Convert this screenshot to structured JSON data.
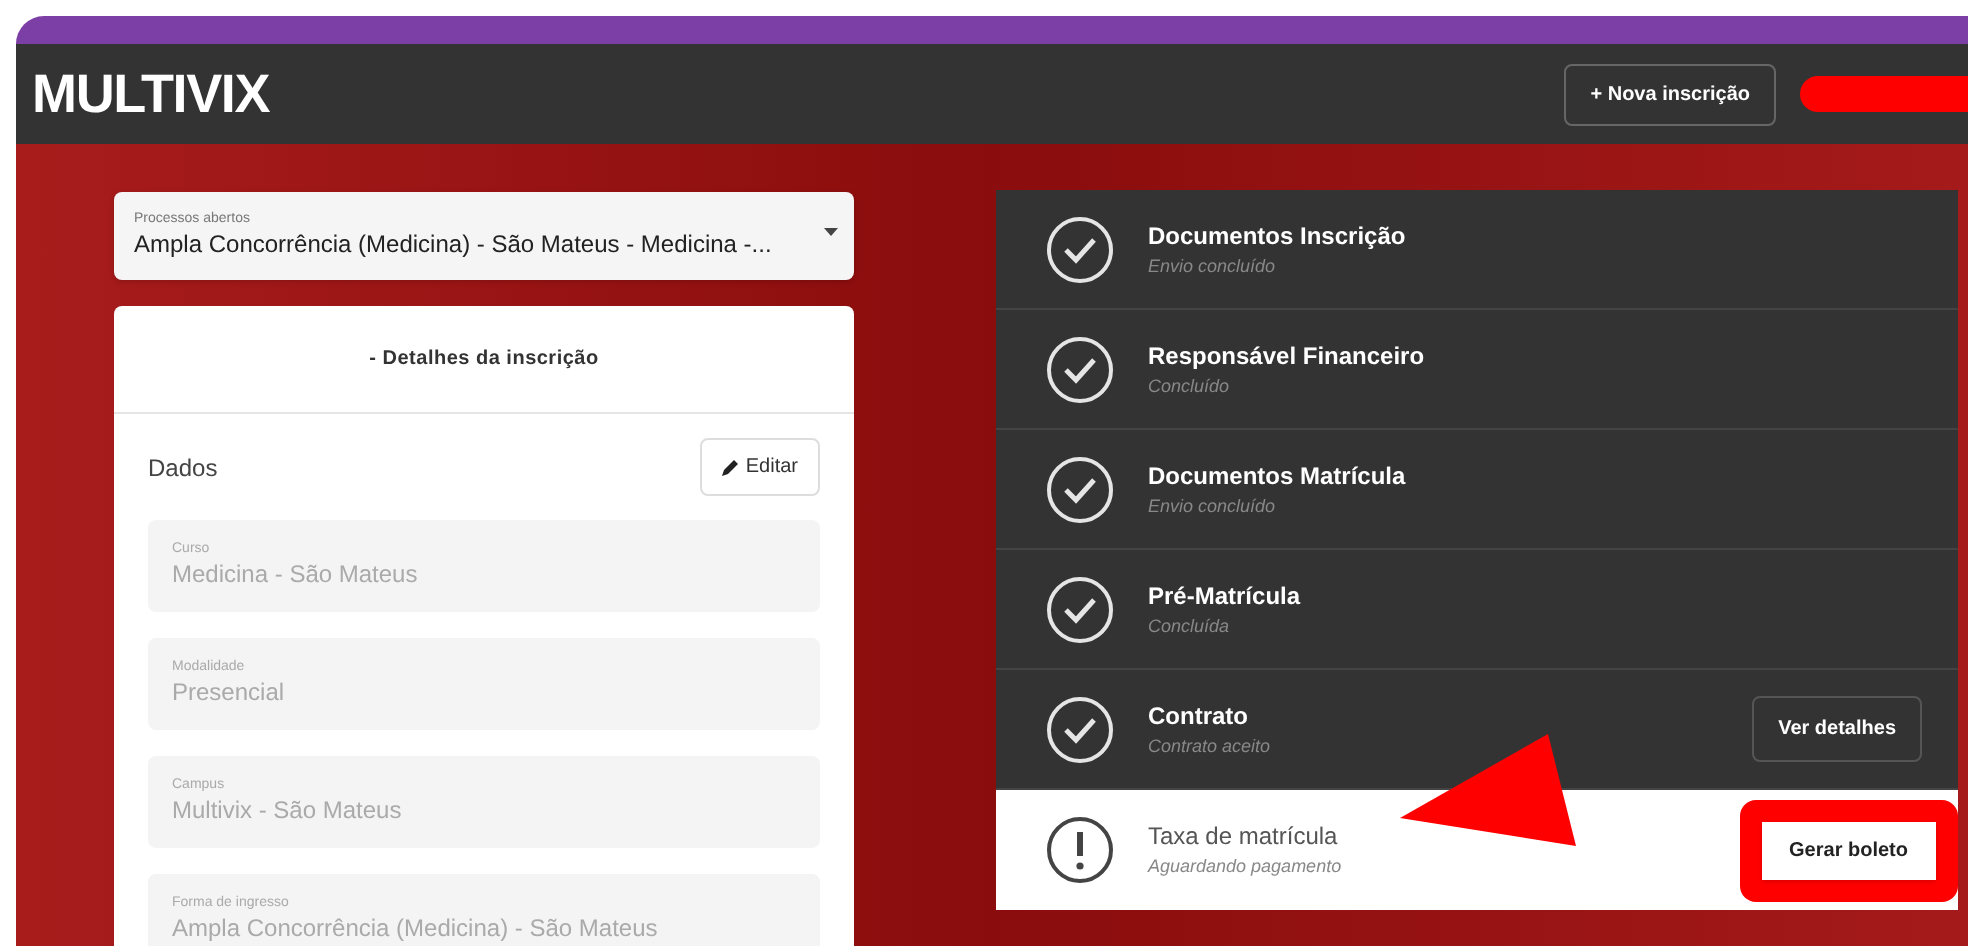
{
  "header": {
    "logo": "MULTIVIX",
    "new_button": "+ Nova inscrição"
  },
  "process_select": {
    "label": "Processos abertos",
    "value": "Ampla Concorrência (Medicina) - São Mateus - Medicina -..."
  },
  "details_card": {
    "toggle": "- Detalhes da inscrição",
    "section_title": "Dados",
    "edit_button": "Editar",
    "fields": [
      {
        "label": "Curso",
        "value": "Medicina - São Mateus",
        "disabled": true
      },
      {
        "label": "Modalidade",
        "value": "Presencial",
        "disabled": true
      },
      {
        "label": "Campus",
        "value": "Multivix - São Mateus",
        "disabled": true
      },
      {
        "label": "Forma de ingresso",
        "value": "Ampla Concorrência (Medicina) - São Mateus",
        "disabled": true
      }
    ]
  },
  "steps": [
    {
      "title": "Documentos Inscrição",
      "subtitle": "Envio concluído",
      "completed": true
    },
    {
      "title": "Responsável Financeiro",
      "subtitle": "Concluído",
      "completed": true
    },
    {
      "title": "Documentos Matrícula",
      "subtitle": "Envio concluído",
      "completed": true
    },
    {
      "title": "Pré-Matrícula",
      "subtitle": "Concluída",
      "completed": true
    },
    {
      "title": "Contrato",
      "subtitle": "Contrato aceito",
      "completed": true,
      "button": "Ver detalhes"
    },
    {
      "title": "Taxa de matrícula",
      "subtitle": "Aguardando pagamento",
      "completed": false,
      "button": "Gerar boleto",
      "highlighted": true
    }
  ]
}
